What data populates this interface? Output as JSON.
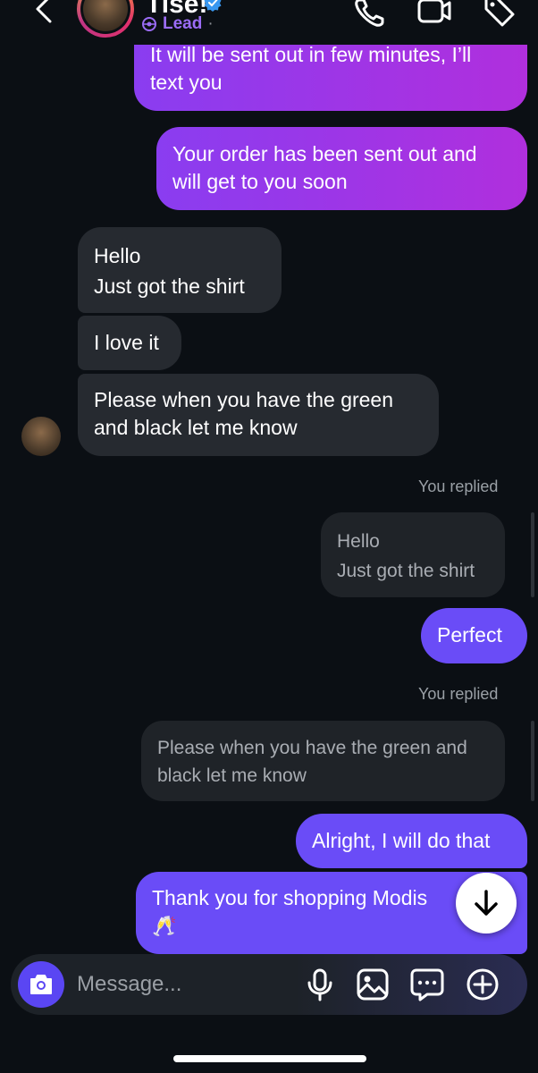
{
  "header": {
    "name": "Tise!",
    "label": "Lead",
    "label_suffix": "·"
  },
  "messages": {
    "m1": "It will be sent out in few minutes, I’ll text you",
    "m1_line1": "It will be sent out in few minutes, I’ll",
    "m1_line2": "text you",
    "m2_line1": "Your order has been sent out and",
    "m2_line2": "will get to you soon",
    "m3_line1": "Hello",
    "m3_line2": "Just got the shirt",
    "m4": "I love it",
    "m5_line1": "Please when you have the green",
    "m5_line2": "and black let me know",
    "replied_1": "You replied",
    "quote1_line1": "Hello",
    "quote1_line2": "Just got the shirt",
    "m6": "Perfect",
    "replied_2": "You replied",
    "quote2_line1": "Please when you have the green and",
    "quote2_line2": "black let me know",
    "m7": "Alright, I will do that",
    "m8_line1": "Thank you for shopping Modis",
    "m8_emoji": "🥂"
  },
  "composer": {
    "placeholder": "Message..."
  },
  "icons": {
    "back": "chevron-left-icon",
    "verified": "verified-badge-icon",
    "lead": "lead-tag-icon",
    "call": "phone-icon",
    "video": "video-camera-icon",
    "tag": "tag-icon",
    "scroll_down": "arrow-down-icon",
    "camera": "camera-icon",
    "mic": "microphone-icon",
    "gallery": "image-icon",
    "sticker": "chat-bubble-icon",
    "add": "plus-circle-icon"
  },
  "colors": {
    "background": "#0b0f14",
    "outgoing_purple": "#b02fdd",
    "outgoing_blue": "#6a4cf7",
    "incoming": "#262a30",
    "lead": "#9b6cf6",
    "verified": "#3897f0"
  }
}
